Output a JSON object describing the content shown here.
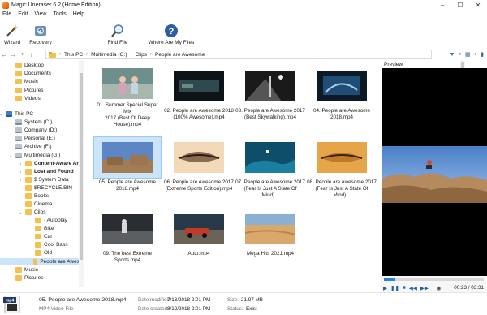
{
  "window": {
    "title": "Magic Uneraser 6.2 (Home Edition)",
    "controls": [
      "–",
      "☐",
      "✕"
    ]
  },
  "menu": [
    "File",
    "Edit",
    "View",
    "Tools",
    "Help"
  ],
  "toolbar": {
    "wizard": "Wizard",
    "recovery": "Recovery",
    "find_file": "Find File",
    "where_are_my_files": "Where Are My Files"
  },
  "breadcrumb": [
    "This PC",
    "Multimedia (G:)",
    "Clips",
    "People are Awesome"
  ],
  "tree": [
    {
      "label": "Desktop",
      "icon": "folder",
      "arrow": "›"
    },
    {
      "label": "Documents",
      "icon": "folder",
      "arrow": "›"
    },
    {
      "label": "Music",
      "icon": "folder",
      "arrow": "›"
    },
    {
      "label": "Pictures",
      "icon": "folder",
      "arrow": "›"
    },
    {
      "label": "Videos",
      "icon": "folder",
      "arrow": "›"
    },
    {
      "label": "This PC",
      "icon": "pc",
      "arrow": "⌄"
    },
    {
      "label": "System (C:)",
      "icon": "drive",
      "arrow": "›"
    },
    {
      "label": "Company (D:)",
      "icon": "drive",
      "arrow": "›"
    },
    {
      "label": "Personal (E:)",
      "icon": "drive",
      "arrow": "›"
    },
    {
      "label": "Archive (F:)",
      "icon": "drive",
      "arrow": "›"
    },
    {
      "label": "Multimedia (G:)",
      "icon": "drive",
      "arrow": "⌄"
    },
    {
      "label": "Content-Aware Ana",
      "icon": "folder",
      "arrow": "›",
      "bold": true
    },
    {
      "label": "Lost and Found",
      "icon": "folder",
      "arrow": "›",
      "bold": true
    },
    {
      "label": "$ System Data",
      "icon": "folder",
      "arrow": "›"
    },
    {
      "label": "$RECYCLE.BIN",
      "icon": "folder",
      "arrow": ""
    },
    {
      "label": "Books",
      "icon": "folder",
      "arrow": ""
    },
    {
      "label": "Cinema",
      "icon": "folder",
      "arrow": ""
    },
    {
      "label": "Clips",
      "icon": "folder",
      "arrow": "⌄"
    },
    {
      "label": "- Autoplay",
      "icon": "folder",
      "arrow": ""
    },
    {
      "label": "Bike",
      "icon": "folder",
      "arrow": ""
    },
    {
      "label": "Car",
      "icon": "folder",
      "arrow": ""
    },
    {
      "label": "Cool Bass",
      "icon": "folder",
      "arrow": ""
    },
    {
      "label": "Old",
      "icon": "folder",
      "arrow": ""
    },
    {
      "label": "People are Awes",
      "icon": "folder",
      "arrow": "",
      "selected": true
    },
    {
      "label": "Music",
      "icon": "folder",
      "arrow": ""
    },
    {
      "label": "Pictures",
      "icon": "folder",
      "arrow": ""
    }
  ],
  "files": [
    {
      "name": "01. Summer Special Super Mix 2017 (Best Of Deep House).mp4",
      "line1": "01. Summer Special Super Mix",
      "line2": "2017 (Best Of Deep House).mp4"
    },
    {
      "name": "02. People are Awesome 2018 (100% Awesome).mp4",
      "line1": "02. People are Awesome 2018",
      "line2": "(100% Awesome).mp4"
    },
    {
      "name": "03. People are Awesome 2017 (Best Skywalking).mp4",
      "line1": "03. People are Awesome 2017",
      "line2": "(Best Skywalking).mp4"
    },
    {
      "name": "04. People are Awesome 2018.mp4",
      "line1": "04. People are Awesome",
      "line2": "2018.mp4"
    },
    {
      "name": "05. People are Awesome 2018.mp4",
      "line1": "05. People are Awesome",
      "line2": "2018.mp4",
      "selected": true
    },
    {
      "name": "06. People are Awesome 2017 (Extreme Sports Edition).mp4",
      "line1": "06. People are Awesome 2017",
      "line2": "(Extreme Sports Edition).mp4"
    },
    {
      "name": "07. People are Awesome 2017 (Fear Is Just A State Of Mind).mp4",
      "line1": "07. People are Awesome 2017",
      "line2": "(Fear Is Just A State Of Mind)..."
    },
    {
      "name": "08. People are Awesome 2017 (Fear Is Just A State Of Mind).mp4",
      "line1": "08. People are Awesome 2017",
      "line2": "(Fear Is Just A State Of Mind)..."
    },
    {
      "name": "09. The best Extreme Sports.mp4",
      "line1": "09. The best Extreme",
      "line2": "Sports.mp4"
    },
    {
      "name": "Auto.mp4",
      "line1": "Auto.mp4",
      "line2": ""
    },
    {
      "name": "Mega Hits 2021.mp4",
      "line1": "Mega Hits 2021.mp4",
      "line2": ""
    }
  ],
  "preview": {
    "title": "Preview",
    "time": "00:23 / 03:31",
    "progress": 0.11
  },
  "status": {
    "file_name": "05. People are Awesome 2018.mp4",
    "file_type": "MP4 Video File",
    "icon_label": "mp4",
    "modified_label": "Date modified:",
    "modified_value": "7/13/2018 2:01 PM",
    "created_label": "Date created:",
    "created_value": "8/12/2018 2:01 PM",
    "size_label": "Size:",
    "size_value": "21.97 MB",
    "status_label": "Status:",
    "status_value": "Exist"
  },
  "colors": {
    "accent": "#2f7ed8",
    "selection": "#cce4f7",
    "folder": "#f2c14e"
  }
}
